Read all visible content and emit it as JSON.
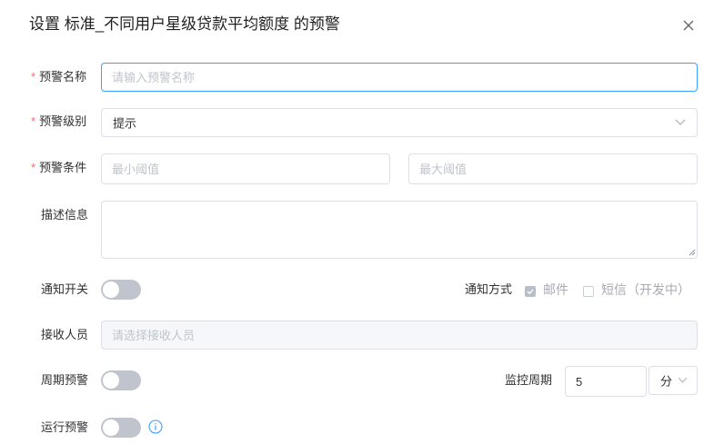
{
  "dialog": {
    "title": "设置 标准_不同用户星级贷款平均额度 的预警",
    "close_icon": "close-icon"
  },
  "form": {
    "required_mark": "*",
    "name": {
      "label": "预警名称",
      "placeholder": "请输入预警名称",
      "value": ""
    },
    "level": {
      "label": "预警级别",
      "value": "提示",
      "icon": "chevron-down-icon"
    },
    "condition": {
      "label": "预警条件",
      "min_placeholder": "最小阈值",
      "max_placeholder": "最大阈值"
    },
    "description": {
      "label": "描述信息",
      "value": ""
    },
    "notify_switch": {
      "label": "通知开关",
      "on": false
    },
    "notify_method": {
      "label": "通知方式",
      "options": [
        {
          "label": "邮件",
          "checked": true
        },
        {
          "label": "短信（开发中）",
          "checked": false
        }
      ]
    },
    "recipients": {
      "label": "接收人员",
      "placeholder": "请选择接收人员"
    },
    "periodic": {
      "label": "周期预警",
      "on": false
    },
    "monitor_period": {
      "label": "监控周期",
      "value": "5",
      "unit": "分",
      "icon": "chevron-down-icon"
    },
    "run_alert": {
      "label": "运行预警",
      "on": false,
      "icon": "info-icon"
    }
  },
  "colors": {
    "required": "#f56c6c",
    "focus_border": "#409eff",
    "border": "#dcdfe6",
    "info": "#409eff",
    "switch_off": "#c0c4cc"
  }
}
